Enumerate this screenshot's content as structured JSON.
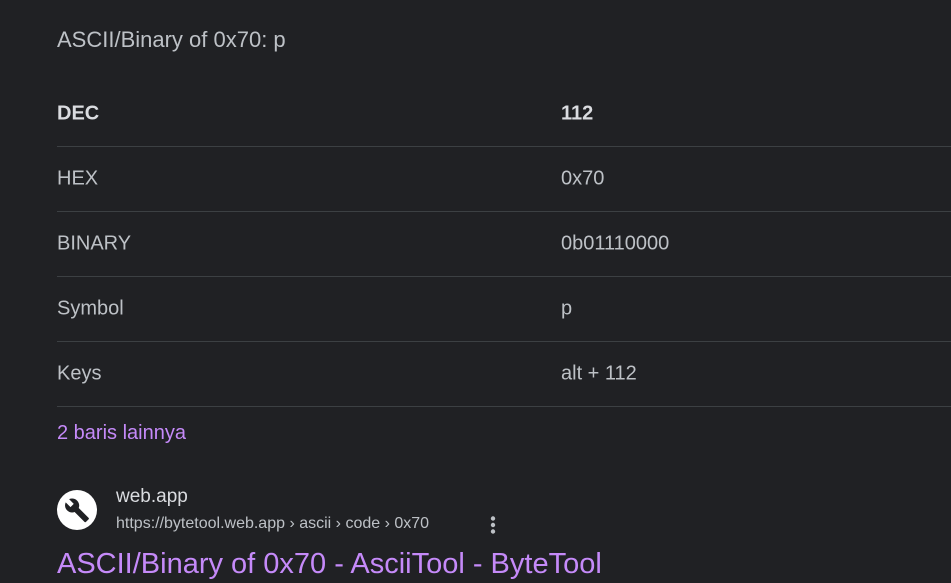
{
  "snippet": {
    "title": "ASCII/Binary of 0x70: p",
    "header": {
      "key": "DEC",
      "value": "112"
    },
    "rows": [
      {
        "key": "HEX",
        "value": "0x70"
      },
      {
        "key": "BINARY",
        "value": "0b01110000"
      },
      {
        "key": "Symbol",
        "value": "p"
      },
      {
        "key": "Keys",
        "value": "alt + 112"
      }
    ],
    "more_rows": "2 baris lainnya"
  },
  "result": {
    "favicon": "wrench-icon",
    "site_name": "web.app",
    "breadcrumb": "https://bytetool.web.app › ascii › code › 0x70",
    "title": "ASCII/Binary of 0x70 - AsciiTool - ByteTool",
    "menu_icon": "more-vert-icon"
  },
  "colors": {
    "background": "#202124",
    "text": "#bdc1c6",
    "divider": "#3c4043",
    "link": "#c58af9"
  }
}
